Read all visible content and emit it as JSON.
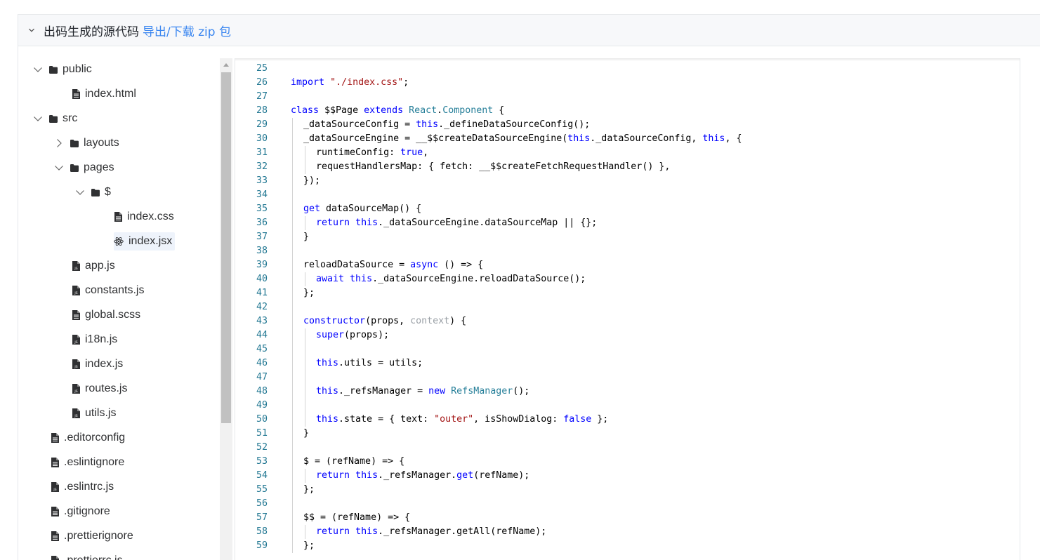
{
  "header": {
    "title": "出码生成的源代码",
    "link_label": "导出/下载 zip 包",
    "chevron_icon": "chevron-down-icon"
  },
  "tree": [
    {
      "label": "public",
      "type": "folder",
      "expanded": true,
      "indent": 0,
      "twisty": "down"
    },
    {
      "label": "index.html",
      "type": "file",
      "indent": 1
    },
    {
      "label": "src",
      "type": "folder",
      "expanded": true,
      "indent": 0,
      "twisty": "down"
    },
    {
      "label": "layouts",
      "type": "folder",
      "expanded": false,
      "indent": 1,
      "twisty": "right"
    },
    {
      "label": "pages",
      "type": "folder",
      "expanded": true,
      "indent": 1,
      "twisty": "down"
    },
    {
      "label": "$",
      "type": "folder",
      "expanded": true,
      "indent": 2,
      "twisty": "down"
    },
    {
      "label": "index.css",
      "type": "file",
      "indent": 3
    },
    {
      "label": "index.jsx",
      "type": "react",
      "indent": 3,
      "selected": true
    },
    {
      "label": "app.js",
      "type": "js",
      "indent": 1
    },
    {
      "label": "constants.js",
      "type": "js",
      "indent": 1
    },
    {
      "label": "global.scss",
      "type": "file",
      "indent": 1
    },
    {
      "label": "i18n.js",
      "type": "js",
      "indent": 1
    },
    {
      "label": "index.js",
      "type": "js",
      "indent": 1
    },
    {
      "label": "routes.js",
      "type": "js",
      "indent": 1
    },
    {
      "label": "utils.js",
      "type": "js",
      "indent": 1
    },
    {
      "label": ".editorconfig",
      "type": "file",
      "indent": 0
    },
    {
      "label": ".eslintignore",
      "type": "file",
      "indent": 0
    },
    {
      "label": ".eslintrc.js",
      "type": "js",
      "indent": 0
    },
    {
      "label": ".gitignore",
      "type": "file",
      "indent": 0
    },
    {
      "label": ".prettierignore",
      "type": "file",
      "indent": 0
    },
    {
      "label": ".prettierrc.js",
      "type": "js",
      "indent": 0
    }
  ],
  "editor": {
    "lines": [
      {
        "n": "25",
        "indent": 0,
        "tokens": []
      },
      {
        "n": "26",
        "indent": 0,
        "tokens": [
          [
            "kw",
            "import"
          ],
          [
            "",
            " "
          ],
          [
            "str",
            "\"./index.css\""
          ],
          [
            "",
            ";"
          ]
        ]
      },
      {
        "n": "27",
        "indent": 0,
        "tokens": []
      },
      {
        "n": "28",
        "indent": 0,
        "tokens": [
          [
            "kw",
            "class"
          ],
          [
            "",
            " $$Page "
          ],
          [
            "kw",
            "extends"
          ],
          [
            "",
            " "
          ],
          [
            "typ",
            "React"
          ],
          [
            "",
            "."
          ],
          [
            "typ",
            "Component"
          ],
          [
            "",
            " {"
          ]
        ]
      },
      {
        "n": "29",
        "indent": 1,
        "tokens": [
          [
            "",
            "_dataSourceConfig = "
          ],
          [
            "kw",
            "this"
          ],
          [
            "",
            "._defineDataSourceConfig();"
          ]
        ]
      },
      {
        "n": "30",
        "indent": 1,
        "tokens": [
          [
            "",
            "_dataSourceEngine = __$$createDataSourceEngine("
          ],
          [
            "kw",
            "this"
          ],
          [
            "",
            "._dataSourceConfig, "
          ],
          [
            "kw",
            "this"
          ],
          [
            "",
            ", {"
          ]
        ]
      },
      {
        "n": "31",
        "indent": 2,
        "tokens": [
          [
            "",
            "runtimeConfig: "
          ],
          [
            "kw",
            "true"
          ],
          [
            "",
            ","
          ]
        ]
      },
      {
        "n": "32",
        "indent": 2,
        "tokens": [
          [
            "",
            "requestHandlersMap: { fetch: __$$createFetchRequestHandler() },"
          ]
        ]
      },
      {
        "n": "33",
        "indent": 1,
        "tokens": [
          [
            "",
            "});"
          ]
        ]
      },
      {
        "n": "34",
        "indent": 1,
        "tokens": []
      },
      {
        "n": "35",
        "indent": 1,
        "tokens": [
          [
            "kw",
            "get"
          ],
          [
            "",
            " dataSourceMap() {"
          ]
        ]
      },
      {
        "n": "36",
        "indent": 2,
        "tokens": [
          [
            "kw",
            "return"
          ],
          [
            "",
            " "
          ],
          [
            "kw",
            "this"
          ],
          [
            "",
            "._dataSourceEngine.dataSourceMap || {};"
          ]
        ]
      },
      {
        "n": "37",
        "indent": 1,
        "tokens": [
          [
            "",
            "}"
          ]
        ]
      },
      {
        "n": "38",
        "indent": 1,
        "tokens": []
      },
      {
        "n": "39",
        "indent": 1,
        "tokens": [
          [
            "",
            "reloadDataSource = "
          ],
          [
            "kw",
            "async"
          ],
          [
            "",
            " () => {"
          ]
        ]
      },
      {
        "n": "40",
        "indent": 2,
        "tokens": [
          [
            "kw",
            "await"
          ],
          [
            "",
            " "
          ],
          [
            "kw",
            "this"
          ],
          [
            "",
            "._dataSourceEngine.reloadDataSource();"
          ]
        ]
      },
      {
        "n": "41",
        "indent": 1,
        "tokens": [
          [
            "",
            "};"
          ]
        ]
      },
      {
        "n": "42",
        "indent": 1,
        "tokens": []
      },
      {
        "n": "43",
        "indent": 1,
        "tokens": [
          [
            "kw",
            "constructor"
          ],
          [
            "",
            "(props, "
          ],
          [
            "dim",
            "context"
          ],
          [
            "",
            ") {"
          ]
        ]
      },
      {
        "n": "44",
        "indent": 2,
        "tokens": [
          [
            "kw",
            "super"
          ],
          [
            "",
            "(props);"
          ]
        ]
      },
      {
        "n": "45",
        "indent": 2,
        "tokens": []
      },
      {
        "n": "46",
        "indent": 2,
        "tokens": [
          [
            "kw",
            "this"
          ],
          [
            "",
            ".utils = utils;"
          ]
        ]
      },
      {
        "n": "47",
        "indent": 2,
        "tokens": []
      },
      {
        "n": "48",
        "indent": 2,
        "tokens": [
          [
            "kw",
            "this"
          ],
          [
            "",
            "._refsManager = "
          ],
          [
            "kw",
            "new"
          ],
          [
            "",
            " "
          ],
          [
            "typ",
            "RefsManager"
          ],
          [
            "",
            "();"
          ]
        ]
      },
      {
        "n": "49",
        "indent": 2,
        "tokens": []
      },
      {
        "n": "50",
        "indent": 2,
        "tokens": [
          [
            "kw",
            "this"
          ],
          [
            "",
            ".state = { text: "
          ],
          [
            "str",
            "\"outer\""
          ],
          [
            "",
            ", isShowDialog: "
          ],
          [
            "kw",
            "false"
          ],
          [
            "",
            " };"
          ]
        ]
      },
      {
        "n": "51",
        "indent": 1,
        "tokens": [
          [
            "",
            "}"
          ]
        ]
      },
      {
        "n": "52",
        "indent": 1,
        "tokens": []
      },
      {
        "n": "53",
        "indent": 1,
        "tokens": [
          [
            "",
            "$ = (refName) => {"
          ]
        ]
      },
      {
        "n": "54",
        "indent": 2,
        "tokens": [
          [
            "kw",
            "return"
          ],
          [
            "",
            " "
          ],
          [
            "kw",
            "this"
          ],
          [
            "",
            "._refsManager."
          ],
          [
            "kw",
            "get"
          ],
          [
            "",
            "(refName);"
          ]
        ]
      },
      {
        "n": "55",
        "indent": 1,
        "tokens": [
          [
            "",
            "};"
          ]
        ]
      },
      {
        "n": "56",
        "indent": 1,
        "tokens": []
      },
      {
        "n": "57",
        "indent": 1,
        "tokens": [
          [
            "",
            "$$ = (refName) => {"
          ]
        ]
      },
      {
        "n": "58",
        "indent": 2,
        "tokens": [
          [
            "kw",
            "return"
          ],
          [
            "",
            " "
          ],
          [
            "kw",
            "this"
          ],
          [
            "",
            "._refsManager.getAll(refName);"
          ]
        ]
      },
      {
        "n": "59",
        "indent": 1,
        "tokens": [
          [
            "",
            "};"
          ]
        ]
      }
    ]
  }
}
